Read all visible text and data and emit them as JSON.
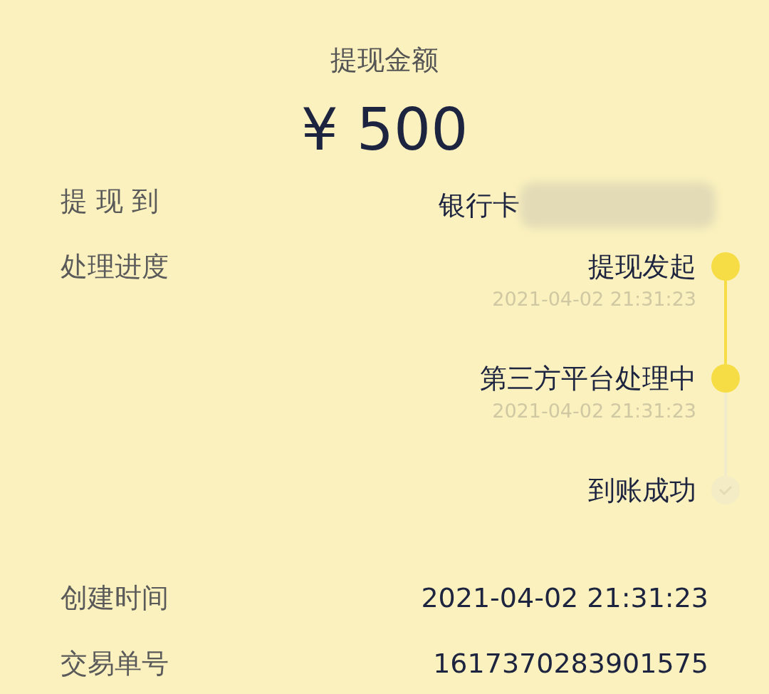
{
  "header": {
    "title": "提现金额",
    "amount": "¥ 500"
  },
  "destination": {
    "label": "提 现 到",
    "value": "银行卡"
  },
  "progress": {
    "label": "处理进度",
    "steps": [
      {
        "title": "提现发起",
        "time": "2021-04-02 21:31:23",
        "done": true
      },
      {
        "title": "第三方平台处理中",
        "time": "2021-04-02 21:31:23",
        "done": true
      },
      {
        "title": "到账成功",
        "done": false
      }
    ]
  },
  "details": [
    {
      "label": "创建时间",
      "value": "2021-04-02 21:31:23"
    },
    {
      "label": "交易单号",
      "value": "1617370283901575"
    }
  ]
}
